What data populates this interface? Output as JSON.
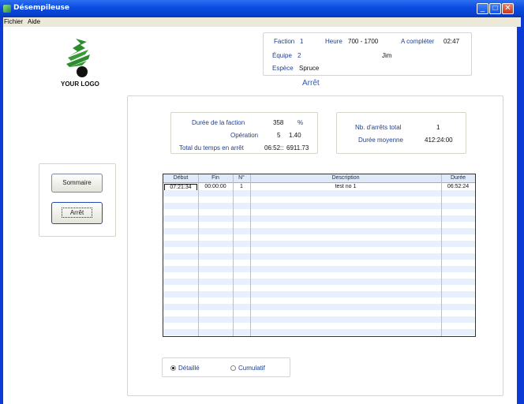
{
  "window": {
    "title": "Désempileuse"
  },
  "menu": [
    {
      "label": "Fichier"
    },
    {
      "label": "Aide"
    }
  ],
  "logo": {
    "text": "YOUR LOGO"
  },
  "header": {
    "faction_label": "Faction",
    "faction_value": "1",
    "heure_label": "Heure",
    "heure_value": "700 - 1700",
    "acompleter_label": "A compléter",
    "acompleter_value": "02:47",
    "equipe_label": "Équipe",
    "equipe_value": "2",
    "operator": "Jim",
    "espece_label": "Espèce",
    "espece_value": "Spruce"
  },
  "section_title": "Arrêt",
  "stats": {
    "duree_faction_label": "Durée de la faction",
    "duree_faction_value": "358",
    "duree_faction_unit": "%",
    "operation_label": "Opération",
    "operation_value": "5",
    "operation_value2": "1.40",
    "total_arret_label": "Total du temps en arrêt",
    "total_arret_value": "06:52::",
    "total_arret_value2": "6911.73",
    "nb_arrets_label": "Nb. d'arrêts total",
    "nb_arrets_value": "1",
    "duree_moyenne_label": "Durée moyenne",
    "duree_moyenne_value": "412:24:00"
  },
  "nav": {
    "sommaire": "Sommaire",
    "arret": "Arrêt"
  },
  "table": {
    "columns": [
      "Début",
      "Fin",
      "N°",
      "Description",
      "Durée"
    ],
    "rows": [
      {
        "debut": "07:21:34",
        "fin": "00:00:00",
        "no": "1",
        "description": "test no 1",
        "duree": "06:52:24"
      }
    ]
  },
  "view_mode": {
    "detaille": "Détaillé",
    "cumulatif": "Cumulatif",
    "selected": "Détaillé"
  },
  "colors": {
    "titlebar": "#0a4be0",
    "accent_text": "#1f3f8f",
    "row_alt": "#e8f1fb"
  }
}
